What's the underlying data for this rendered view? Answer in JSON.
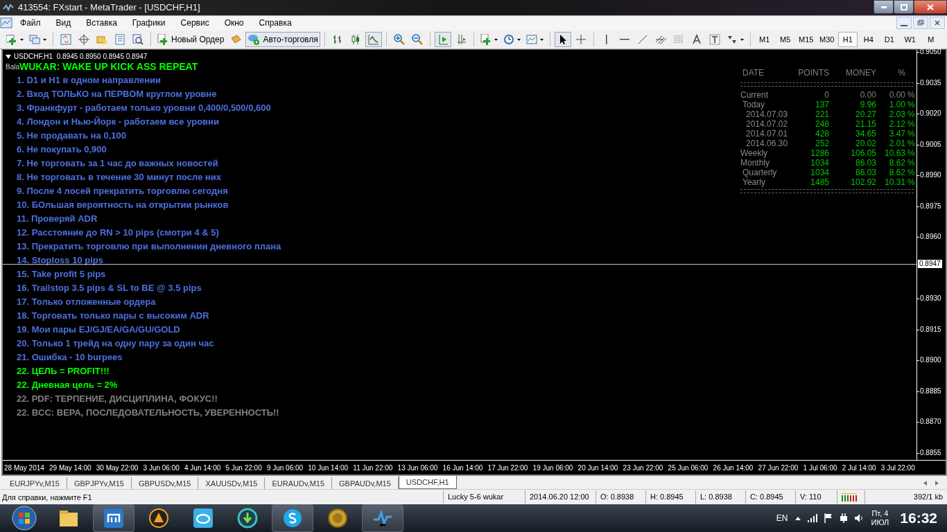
{
  "window": {
    "title": "413554: FXstart - MetaTrader - [USDCHF,H1]"
  },
  "menu": [
    "Файл",
    "Вид",
    "Вставка",
    "Графики",
    "Сервис",
    "Окно",
    "Справка"
  ],
  "toolbar": {
    "new_order": "Новый Ордер",
    "auto_trading": {
      "label": "Авто-торговля",
      "on": true
    },
    "timeframes": [
      {
        "label": "M1",
        "selected": false
      },
      {
        "label": "M5",
        "selected": false
      },
      {
        "label": "M15",
        "selected": false
      },
      {
        "label": "M30",
        "selected": false
      },
      {
        "label": "H1",
        "selected": true
      },
      {
        "label": "H4",
        "selected": false
      },
      {
        "label": "D1",
        "selected": false
      },
      {
        "label": "W1",
        "selected": false
      },
      {
        "label": "M",
        "selected": false
      }
    ]
  },
  "chart": {
    "header": "USDCHF,H1  0.8945 0.8950 0.8945 0.8947",
    "info_line": "Bala",
    "title": "WUKAR: WAKE UP KICK ASS REPEAT",
    "rules": [
      {
        "text": "1. D1 и H1 в одном направлении",
        "color": "#4d6fe0"
      },
      {
        "text": "2. Вход ТОЛЬКО на ПЕРВОМ круглом уровне",
        "color": "#4d6fe0"
      },
      {
        "text": "3. Франкфурт - работаем только уровни 0,400/0,500/0,600",
        "color": "#4d6fe0"
      },
      {
        "text": "4. Лондон и Нью-Йорк - работаем все уровни",
        "color": "#4d6fe0"
      },
      {
        "text": "5. Не продавать на 0,100",
        "color": "#4d6fe0"
      },
      {
        "text": "6. Не покупать 0,900",
        "color": "#4d6fe0"
      },
      {
        "text": "7. Не торговать за 1 час до важных новостей",
        "color": "#4d6fe0"
      },
      {
        "text": "8. Не торговать в течение 30 минут после них",
        "color": "#4d6fe0"
      },
      {
        "text": "9. После 4 лосей прекратить торговлю сегодня",
        "color": "#4d6fe0"
      },
      {
        "text": "10. БОльшая вероятность на открытии рынков",
        "color": "#4d6fe0"
      },
      {
        "text": "11. Проверяй ADR",
        "color": "#4d6fe0"
      },
      {
        "text": "12. Расстояние до RN > 10 pips (смотри 4 & 5)",
        "color": "#4d6fe0"
      },
      {
        "text": "13. Прекратить торговлю при выполнении дневного плана",
        "color": "#4d6fe0"
      },
      {
        "text": "14. Stoploss 10 pips",
        "color": "#4d6fe0"
      },
      {
        "text": "15. Take profit 5 pips",
        "color": "#4d6fe0"
      },
      {
        "text": "16. Trailstop 3.5 pips & SL to BE @ 3.5 pips",
        "color": "#4d6fe0"
      },
      {
        "text": "17. Только отложенные ордера",
        "color": "#4d6fe0"
      },
      {
        "text": "18. Торговать только пары с высоким ADR",
        "color": "#4d6fe0"
      },
      {
        "text": "19. Мои пары EJ/GJ/EA/GA/GU/GOLD",
        "color": "#4d6fe0"
      },
      {
        "text": "20. Только 1 трейд на одну пару за один час",
        "color": "#4d6fe0"
      },
      {
        "text": "21. Ошибка - 10 burpees",
        "color": "#4d6fe0"
      },
      {
        "text": "22. ЦЕЛЬ = PROFIT!!!",
        "color": "#00ff00"
      },
      {
        "text": "22. Дневная цель = 2%",
        "color": "#00ff00"
      },
      {
        "text": "22. PDF: ТЕРПЕНИЕ, ДИСЦИПЛИНА, ФОКУС!!",
        "color": "#808080"
      },
      {
        "text": "22. BCC: ВЕРА, ПОСЛЕДОВАТЕЛЬНОСТЬ, УВЕРЕННОСТЬ!!",
        "color": "#808080"
      }
    ],
    "stats": {
      "columns": [
        "DATE",
        "POINTS",
        "MONEY",
        "%"
      ],
      "rows": [
        {
          "label": "Current",
          "points": "0",
          "money": "0.00",
          "pct": "0.00",
          "sign": "%",
          "color": "#808080"
        },
        {
          "label": "Today",
          "points": "137",
          "money": "9.96",
          "pct": "1.00",
          "sign": "%",
          "color": "#00c800"
        },
        {
          "label": "2014.07.03",
          "points": "221",
          "money": "20.27",
          "pct": "2.03",
          "sign": "%",
          "color": "#00c800"
        },
        {
          "label": "2014.07.02",
          "points": "248",
          "money": "21.15",
          "pct": "2.12",
          "sign": "%",
          "color": "#00c800"
        },
        {
          "label": "2014.07.01",
          "points": "428",
          "money": "34.65",
          "pct": "3.47",
          "sign": "%",
          "color": "#00c800"
        },
        {
          "label": "2014.06.30",
          "points": "252",
          "money": "20.02",
          "pct": "2.01",
          "sign": "%",
          "color": "#00c800"
        },
        {
          "label": "Weekly",
          "points": "1286",
          "money": "106.05",
          "pct": "10.63",
          "sign": "%",
          "color": "#00c800"
        },
        {
          "label": "Monthly",
          "points": "1034",
          "money": "86.03",
          "pct": "8.62",
          "sign": "%",
          "color": "#00c800"
        },
        {
          "label": "Quarterly",
          "points": "1034",
          "money": "86.03",
          "pct": "8.62",
          "sign": "%",
          "color": "#00c800"
        },
        {
          "label": "Yearly",
          "points": "1485",
          "money": "102.92",
          "pct": "10.31",
          "sign": "%",
          "color": "#00c800"
        }
      ]
    },
    "price_axis": [
      "0.9050",
      "0.9035",
      "0.9020",
      "0.9005",
      "0.8990",
      "0.8975",
      "0.8960",
      "0.8930",
      "0.8915",
      "0.8900",
      "0.8885",
      "0.8870",
      "0.8855"
    ],
    "current_price": "0.8947",
    "time_axis": [
      "28 May 2014",
      "29 May 14:00",
      "30 May 22:00",
      "3 Jun 06:00",
      "4 Jun 14:00",
      "5 Jun 22:00",
      "9 Jun 06:00",
      "10 Jun 14:00",
      "11 Jun 22:00",
      "13 Jun 06:00",
      "16 Jun 14:00",
      "17 Jun 22:00",
      "19 Jun 06:00",
      "20 Jun 14:00",
      "23 Jun 22:00",
      "25 Jun 06:00",
      "26 Jun 14:00",
      "27 Jun 22:00",
      "1 Jul 06:00",
      "2 Jul 14:00",
      "3 Jul 22:00"
    ]
  },
  "tabs": [
    {
      "label": "EURJPYv,M15",
      "selected": false
    },
    {
      "label": "GBPJPYv,M15",
      "selected": false
    },
    {
      "label": "GBPUSDv,M15",
      "selected": false
    },
    {
      "label": "XAUUSDv,M15",
      "selected": false
    },
    {
      "label": "EURAUDv,M15",
      "selected": false
    },
    {
      "label": "GBPAUDv,M15",
      "selected": false
    },
    {
      "label": "USDCHF,H1",
      "selected": true
    }
  ],
  "status_bar": {
    "help": "Для справки, нажмите F1",
    "cells": [
      "Lucky 5-6 wukar",
      "2014.06.20 12:00",
      "O: 0.8938",
      "H: 0.8945",
      "L: 0.8938",
      "C: 0.8945",
      "V: 110"
    ],
    "traffic": "392/1 kb"
  },
  "taskbar": {
    "language": "EN",
    "day": "Пт, 4",
    "month": "ИЮЛ",
    "time": "16:32"
  }
}
